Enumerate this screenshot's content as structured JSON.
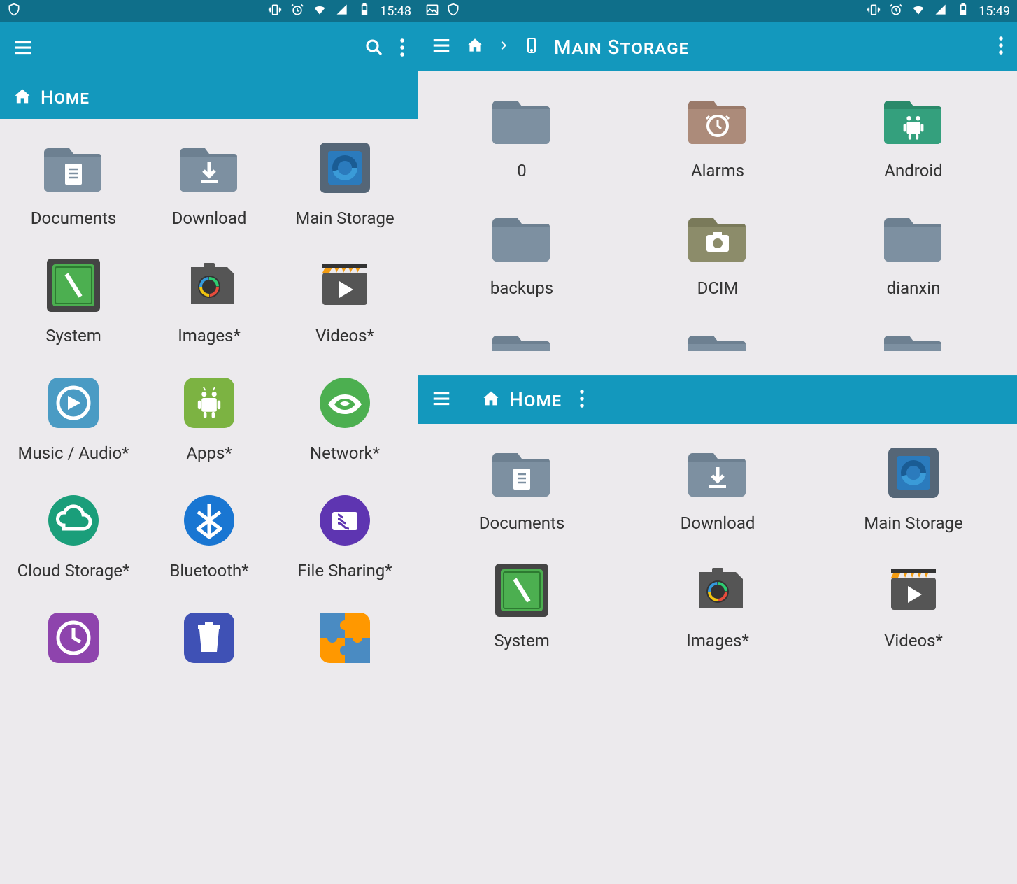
{
  "left": {
    "status": {
      "time": "15:48"
    },
    "title": "Home",
    "items": [
      {
        "label": "Documents",
        "icon": "folder-doc"
      },
      {
        "label": "Download",
        "icon": "folder-download"
      },
      {
        "label": "Main Storage",
        "icon": "storage"
      },
      {
        "label": "System",
        "icon": "system"
      },
      {
        "label": "Images*",
        "icon": "images"
      },
      {
        "label": "Videos*",
        "icon": "videos"
      },
      {
        "label": "Music / Audio*",
        "icon": "music"
      },
      {
        "label": "Apps*",
        "icon": "apps"
      },
      {
        "label": "Network*",
        "icon": "network"
      },
      {
        "label": "Cloud Storage*",
        "icon": "cloud"
      },
      {
        "label": "Bluetooth*",
        "icon": "bluetooth"
      },
      {
        "label": "File Sharing*",
        "icon": "fileshare"
      },
      {
        "label": "",
        "icon": "recent"
      },
      {
        "label": "",
        "icon": "trash"
      },
      {
        "label": "",
        "icon": "plugins"
      }
    ]
  },
  "rightTop": {
    "status": {
      "time": "15:49"
    },
    "breadcrumb": {
      "current": "Main Storage"
    },
    "items": [
      {
        "label": "0",
        "icon": "folder"
      },
      {
        "label": "Alarms",
        "icon": "folder-alarm"
      },
      {
        "label": "Android",
        "icon": "folder-android"
      },
      {
        "label": "backups",
        "icon": "folder"
      },
      {
        "label": "DCIM",
        "icon": "folder-dcim"
      },
      {
        "label": "dianxin",
        "icon": "folder"
      },
      {
        "label": "",
        "icon": "folder-partial"
      },
      {
        "label": "",
        "icon": "folder-partial"
      },
      {
        "label": "",
        "icon": "folder-partial"
      }
    ]
  },
  "rightBottom": {
    "title": "Home",
    "items": [
      {
        "label": "Documents",
        "icon": "folder-doc"
      },
      {
        "label": "Download",
        "icon": "folder-download"
      },
      {
        "label": "Main Storage",
        "icon": "storage"
      },
      {
        "label": "System",
        "icon": "system"
      },
      {
        "label": "Images*",
        "icon": "images"
      },
      {
        "label": "Videos*",
        "icon": "videos"
      }
    ]
  }
}
